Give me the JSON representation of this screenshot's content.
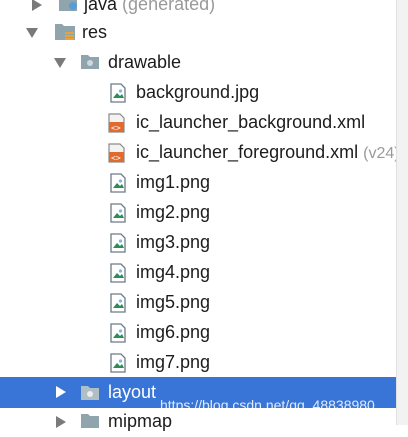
{
  "tree": {
    "java_label": "java",
    "java_suffix": "(generated)",
    "res_label": "res",
    "drawable_label": "drawable",
    "files": [
      {
        "name": "background.jpg",
        "kind": "image"
      },
      {
        "name": "ic_launcher_background.xml",
        "kind": "xml"
      },
      {
        "name": "ic_launcher_foreground.xml",
        "kind": "xml",
        "suffix": "(v24)"
      },
      {
        "name": "img1.png",
        "kind": "image"
      },
      {
        "name": "img2.png",
        "kind": "image"
      },
      {
        "name": "img3.png",
        "kind": "image"
      },
      {
        "name": "img4.png",
        "kind": "image"
      },
      {
        "name": "img5.png",
        "kind": "image"
      },
      {
        "name": "img6.png",
        "kind": "image"
      },
      {
        "name": "img7.png",
        "kind": "image"
      }
    ],
    "layout_label": "layout",
    "mipmap_label": "mipmap"
  },
  "watermark": "https://blog.csdn.net/qq_48838980",
  "colors": {
    "selection": "#3875d7",
    "folder": "#90a4ae",
    "image_icon": "#2e8b57",
    "xml_icon": "#e26a2c"
  }
}
